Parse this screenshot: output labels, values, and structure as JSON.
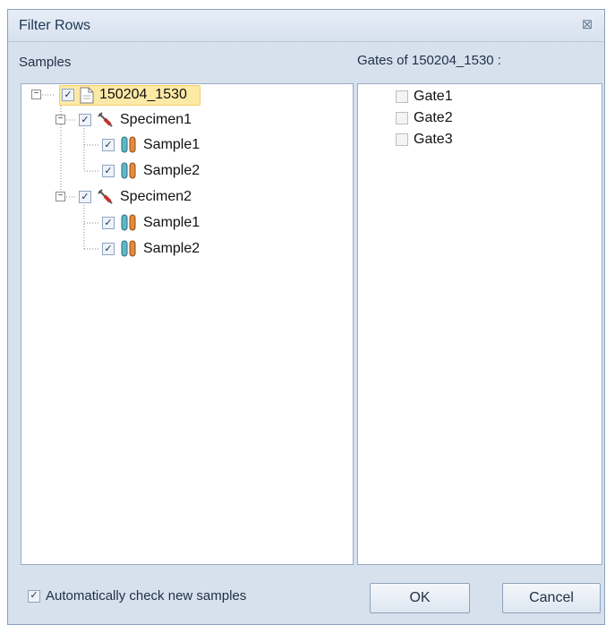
{
  "dialog": {
    "title": "Filter Rows",
    "close_glyph": "⊠"
  },
  "left_pane": {
    "label": "Samples",
    "root": {
      "label": "150204_1530",
      "checked": true,
      "icon": "document-icon"
    },
    "specimens": [
      {
        "label": "Specimen1",
        "checked": true,
        "icon": "syringe-icon",
        "samples": [
          {
            "label": "Sample1",
            "checked": true,
            "icon": "test-tubes-icon"
          },
          {
            "label": "Sample2",
            "checked": true,
            "icon": "test-tubes-icon"
          }
        ]
      },
      {
        "label": "Specimen2",
        "checked": true,
        "icon": "syringe-icon",
        "samples": [
          {
            "label": "Sample1",
            "checked": true,
            "icon": "test-tubes-icon"
          },
          {
            "label": "Sample2",
            "checked": true,
            "icon": "test-tubes-icon"
          }
        ]
      }
    ]
  },
  "right_pane": {
    "label": "Gates of 150204_1530 :",
    "gates": [
      {
        "label": "Gate1",
        "checked": false
      },
      {
        "label": "Gate2",
        "checked": false
      },
      {
        "label": "Gate3",
        "checked": false
      }
    ]
  },
  "footer": {
    "auto_check_label": "Automatically check new samples",
    "auto_check_checked": true,
    "ok_label": "OK",
    "cancel_label": "Cancel"
  },
  "colors": {
    "dialog_bg": "#d7e1ee",
    "highlight_bg": "#fde9a6"
  }
}
